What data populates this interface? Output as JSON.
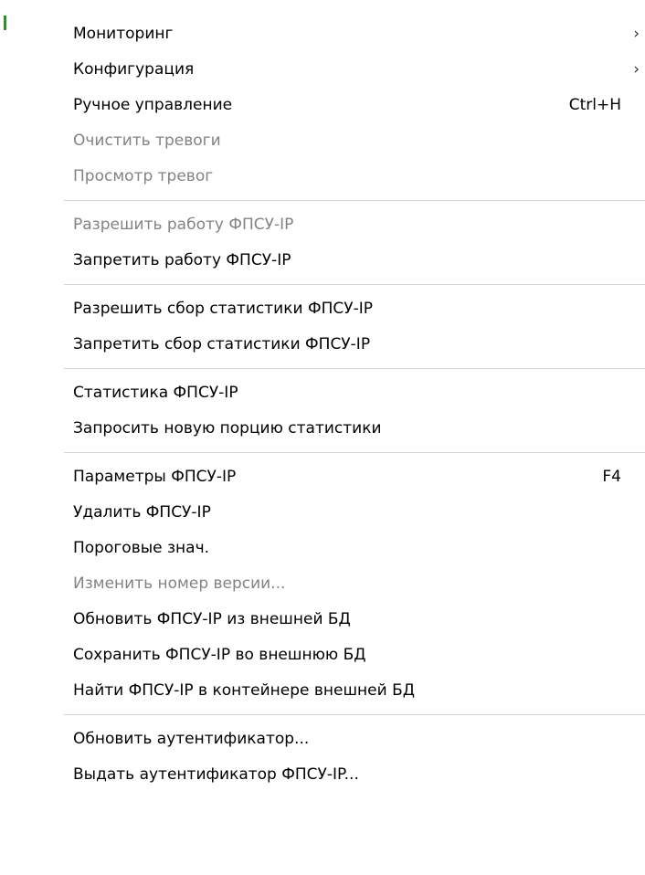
{
  "menu": {
    "items": [
      {
        "label": "Мониторинг",
        "shortcut": "",
        "submenu": true,
        "enabled": true
      },
      {
        "label": "Конфигурация",
        "shortcut": "",
        "submenu": true,
        "enabled": true
      },
      {
        "label": "Ручное управление",
        "shortcut": "Ctrl+H",
        "submenu": false,
        "enabled": true
      },
      {
        "label": "Очистить тревоги",
        "shortcut": "",
        "submenu": false,
        "enabled": false
      },
      {
        "label": "Просмотр тревог",
        "shortcut": "",
        "submenu": false,
        "enabled": false
      },
      {
        "label": "Разрешить работу ФПСУ-IP",
        "shortcut": "",
        "submenu": false,
        "enabled": false
      },
      {
        "label": "Запретить работу ФПСУ-IP",
        "shortcut": "",
        "submenu": false,
        "enabled": true
      },
      {
        "label": "Разрешить сбор статистики ФПСУ-IP",
        "shortcut": "",
        "submenu": false,
        "enabled": true
      },
      {
        "label": "Запретить сбор статистики ФПСУ-IP",
        "shortcut": "",
        "submenu": false,
        "enabled": true
      },
      {
        "label": "Статистика ФПСУ-IP",
        "shortcut": "",
        "submenu": false,
        "enabled": true
      },
      {
        "label": "Запросить новую порцию статистики",
        "shortcut": "",
        "submenu": false,
        "enabled": true
      },
      {
        "label": "Параметры ФПСУ-IP",
        "shortcut": "F4",
        "submenu": false,
        "enabled": true
      },
      {
        "label": "Удалить ФПСУ-IP",
        "shortcut": "",
        "submenu": false,
        "enabled": true
      },
      {
        "label": "Пороговые знач.",
        "shortcut": "",
        "submenu": false,
        "enabled": true
      },
      {
        "label": "Изменить номер версии...",
        "shortcut": "",
        "submenu": false,
        "enabled": false
      },
      {
        "label": "Обновить ФПСУ-IP из внешней БД",
        "shortcut": "",
        "submenu": false,
        "enabled": true
      },
      {
        "label": "Сохранить ФПСУ-IP во внешнюю БД",
        "shortcut": "",
        "submenu": false,
        "enabled": true
      },
      {
        "label": "Найти ФПСУ-IP в контейнере внешней БД",
        "shortcut": "",
        "submenu": false,
        "enabled": true
      },
      {
        "label": "Обновить аутентификатор...",
        "shortcut": "",
        "submenu": false,
        "enabled": true
      },
      {
        "label": "Выдать аутентификатор ФПСУ-IP...",
        "shortcut": "",
        "submenu": false,
        "enabled": true
      }
    ],
    "submenu_arrow": "›",
    "colors": {
      "enabled_text": "#000000",
      "disabled_text": "#838383",
      "separator": "#d4d4d4",
      "background": "#ffffff"
    }
  }
}
